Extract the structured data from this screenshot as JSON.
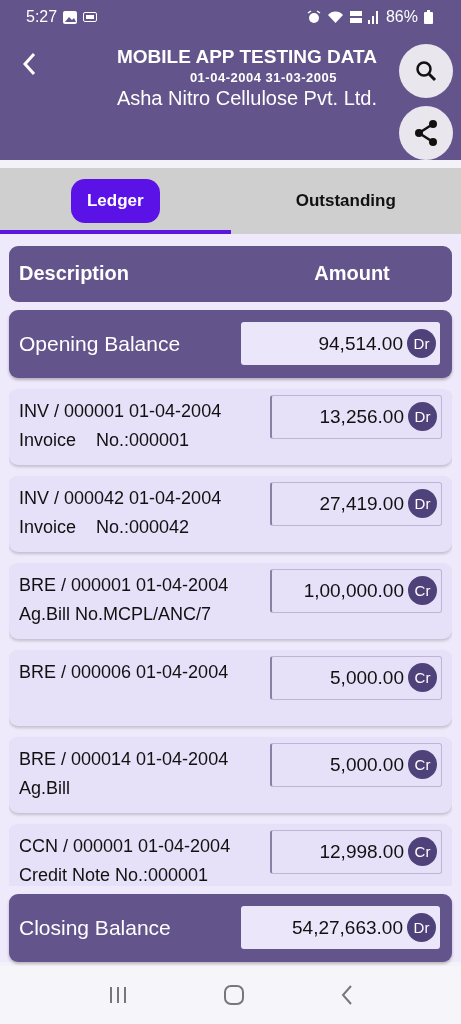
{
  "status_bar": {
    "time": "5:27",
    "battery": "86%"
  },
  "header": {
    "title": "MOBILE APP TESTING DATA",
    "period": "01-04-2004 31-03-2005",
    "company": "Asha Nitro Cellulose Pvt. Ltd."
  },
  "tabs": [
    {
      "label": "Ledger",
      "selected": true
    },
    {
      "label": "Outstanding",
      "selected": false
    }
  ],
  "table": {
    "columns": [
      "Description",
      "Amount"
    ],
    "opening": {
      "label": "Opening Balance",
      "amount": "94,514.00",
      "side": "Dr"
    },
    "rows": [
      {
        "line1": "INV / 000001 01-04-2004",
        "line2": "Invoice    No.:000001",
        "amount": "13,256.00",
        "side": "Dr"
      },
      {
        "line1": "INV / 000042 01-04-2004",
        "line2": "Invoice    No.:000042",
        "amount": "27,419.00",
        "side": "Dr"
      },
      {
        "line1": "BRE / 000001 01-04-2004",
        "line2": "Ag.Bill No.MCPL/ANC/7",
        "amount": "1,00,000.00",
        "side": "Cr"
      },
      {
        "line1": "BRE / 000006 01-04-2004",
        "amount": "5,000.00",
        "side": "Cr"
      },
      {
        "line1": "BRE / 000014 01-04-2004",
        "line2": "Ag.Bill",
        "amount": "5,000.00",
        "side": "Cr"
      },
      {
        "line1": "CCN / 000001 01-04-2004",
        "line2": "Credit Note No.:000001",
        "amount": "12,998.00",
        "side": "Cr"
      }
    ],
    "closing": {
      "label": "Closing Balance",
      "amount": "54,27,663.00",
      "side": "Dr"
    }
  }
}
